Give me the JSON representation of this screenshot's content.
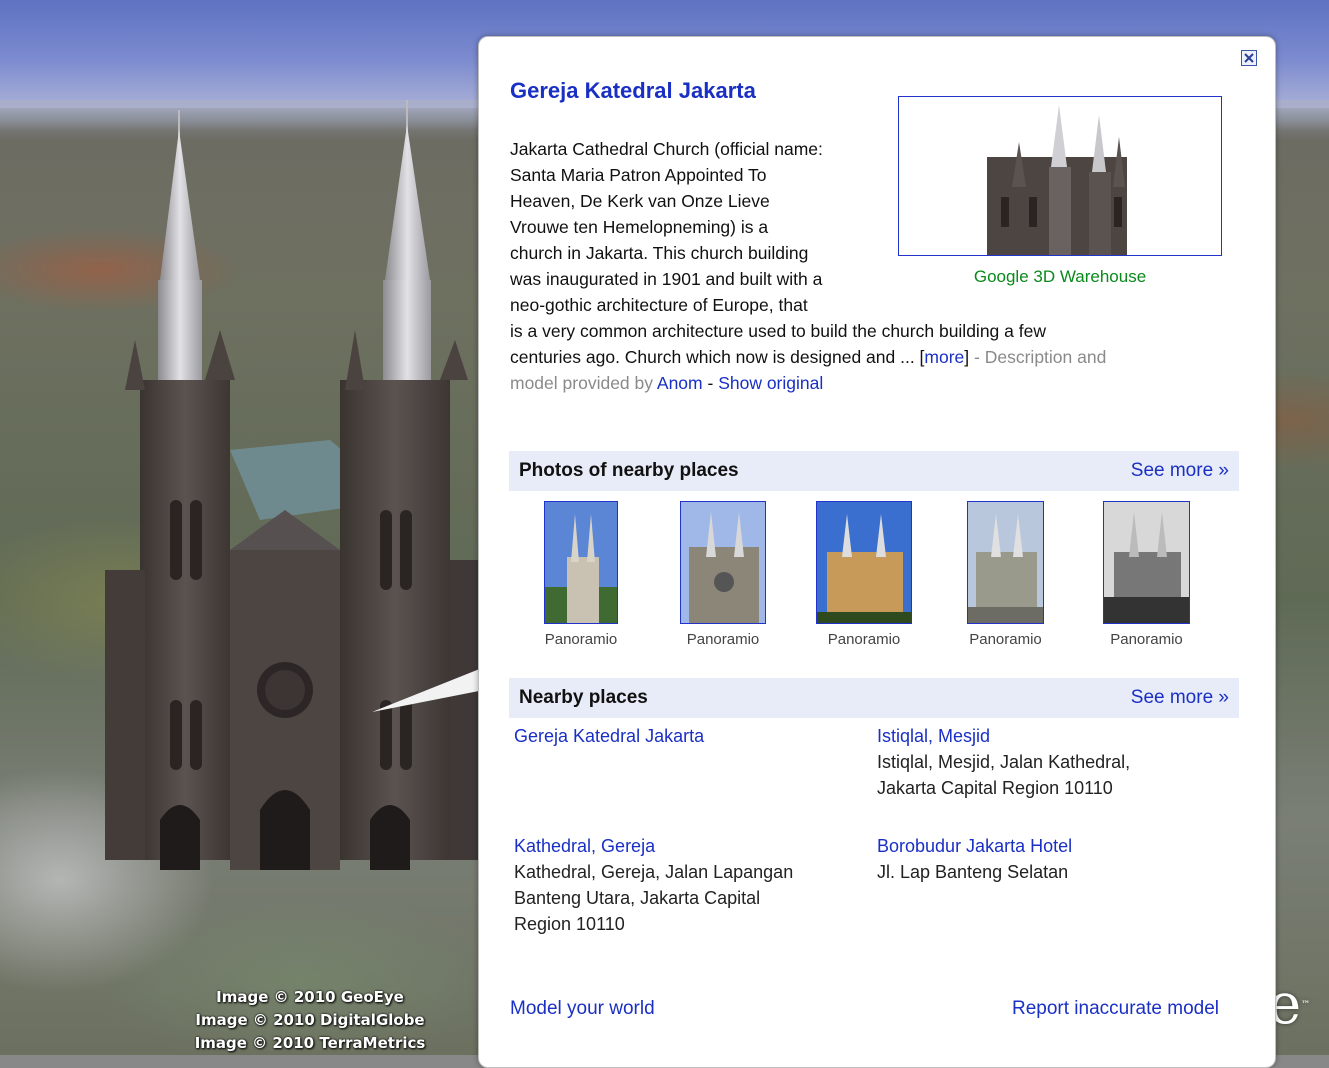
{
  "map": {
    "credits": [
      "Image © 2010 GeoEye",
      "Image © 2010 DigitalGlobe",
      "Image © 2010 TerraMetrics"
    ],
    "logo_fragment": "e"
  },
  "balloon": {
    "title": "Gereja Katedral Jakarta",
    "thumbnail_caption": "Google 3D Warehouse",
    "description_lines": [
      "Jakarta Cathedral Church (official name:",
      "Santa Maria Patron Appointed To",
      "Heaven, De Kerk van Onze Lieve",
      "Vrouwe ten Hemelopneming) is a",
      "church in Jakarta. This church building",
      "was inaugurated in 1901 and built with a",
      "neo-gothic architecture of Europe, that",
      "is a very common architecture used to build the church building a few"
    ],
    "description_tail": "centuries ago. Church which now is designed and ... ",
    "more_link": "more",
    "attribution_prefix": "Description and",
    "attribution_middle": "model provided by",
    "author_link": "Anom",
    "show_original_link": "Show original",
    "separator": " - ",
    "photos_section": {
      "title": "Photos of nearby places",
      "see_more": "See more »",
      "photos": [
        {
          "caption": "Panoramio"
        },
        {
          "caption": "Panoramio"
        },
        {
          "caption": "Panoramio"
        },
        {
          "caption": "Panoramio"
        },
        {
          "caption": "Panoramio"
        }
      ]
    },
    "nearby_section": {
      "title": "Nearby places",
      "see_more": "See more »",
      "places": [
        {
          "name": "Gereja Katedral Jakarta",
          "address": []
        },
        {
          "name": "Istiqlal, Mesjid",
          "address": [
            "Istiqlal, Mesjid, Jalan Kathedral,",
            "Jakarta Capital Region 10110"
          ]
        },
        {
          "name": "Kathedral, Gereja",
          "address": [
            "Kathedral, Gereja, Jalan Lapangan",
            "Banteng Utara, Jakarta Capital",
            "Region 10110"
          ]
        },
        {
          "name": "Borobudur Jakarta Hotel",
          "address": [
            "Jl. Lap Banteng Selatan"
          ]
        }
      ]
    },
    "footer": {
      "left_link": "Model your world",
      "right_link": "Report inaccurate model"
    }
  },
  "colors": {
    "link": "#1a2fc4",
    "section_bg": "#e8ecf8",
    "caption_green": "#0a8a1a"
  }
}
